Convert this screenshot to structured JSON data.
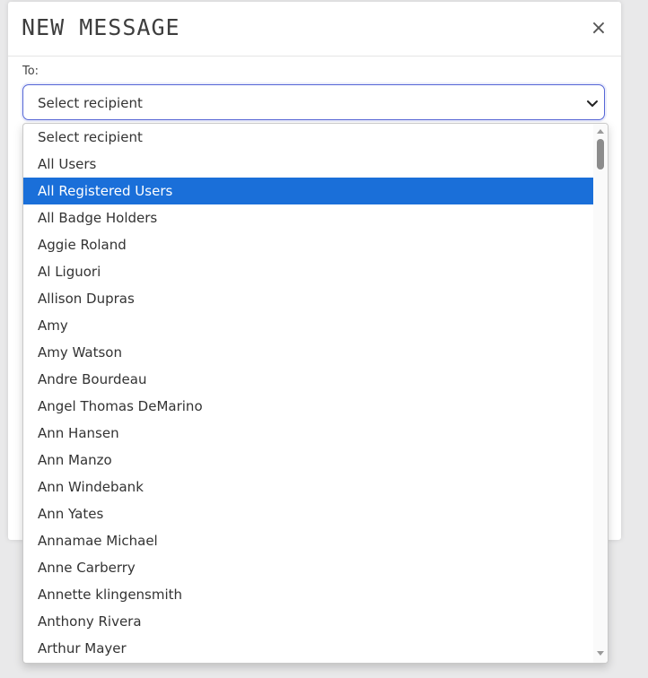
{
  "modal": {
    "title": "NEW MESSAGE",
    "close_label": "×",
    "to_label": "To:",
    "recipient_select": {
      "selected": "Select recipient"
    }
  },
  "dropdown": {
    "highlighted_index": 2,
    "options": [
      "Select recipient",
      "All Users",
      "All Registered Users",
      "All Badge Holders",
      "Aggie Roland",
      "Al Liguori",
      "Allison Dupras",
      "Amy",
      "Amy Watson",
      "Andre Bourdeau",
      "Angel Thomas DeMarino",
      "Ann Hansen",
      "Ann Manzo",
      "Ann Windebank",
      "Ann Yates",
      "Annamae Michael",
      "Anne Carberry",
      "Annette klingensmith",
      "Anthony Rivera",
      "Arthur Mayer"
    ]
  },
  "icons": {
    "close": "close-icon",
    "caret": "chevron-down-icon",
    "scroll_up": "scroll-up-arrow-icon",
    "scroll_down": "scroll-down-arrow-icon"
  },
  "colors": {
    "highlight": "#1a6fd9",
    "select_border": "#5566d6",
    "modal_bg": "#ffffff",
    "page_bg": "#e9e9ea"
  }
}
